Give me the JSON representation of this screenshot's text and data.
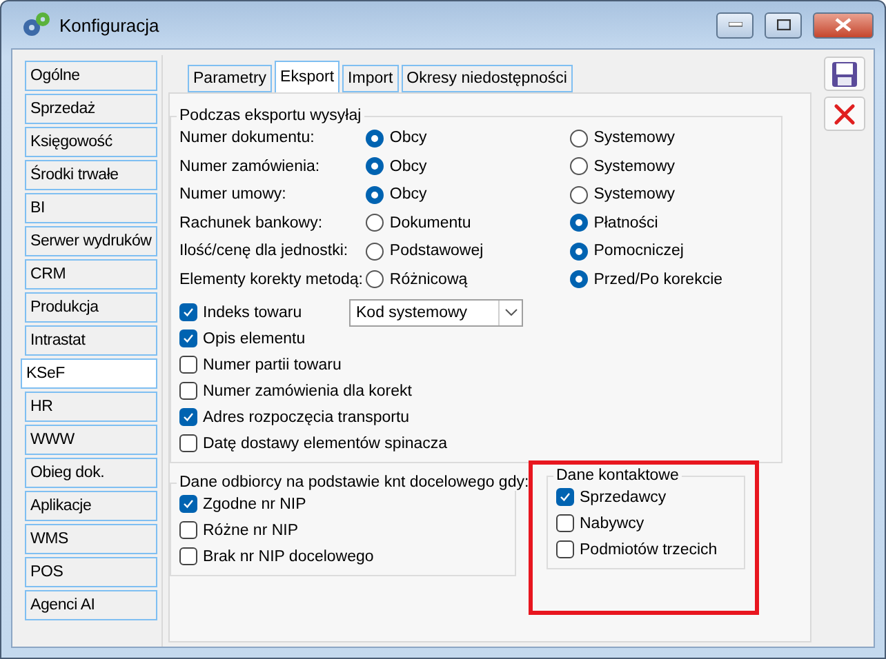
{
  "window": {
    "title": "Konfiguracja"
  },
  "sidebar": {
    "items": [
      {
        "label": "Ogólne",
        "selected": false
      },
      {
        "label": "Sprzedaż",
        "selected": false
      },
      {
        "label": "Księgowość",
        "selected": false
      },
      {
        "label": "Środki trwałe",
        "selected": false
      },
      {
        "label": "BI",
        "selected": false
      },
      {
        "label": "Serwer wydruków",
        "selected": false
      },
      {
        "label": "CRM",
        "selected": false
      },
      {
        "label": "Produkcja",
        "selected": false
      },
      {
        "label": "Intrastat",
        "selected": false
      },
      {
        "label": "KSeF",
        "selected": true
      },
      {
        "label": "HR",
        "selected": false
      },
      {
        "label": "WWW",
        "selected": false
      },
      {
        "label": "Obieg dok.",
        "selected": false
      },
      {
        "label": "Aplikacje",
        "selected": false
      },
      {
        "label": "WMS",
        "selected": false
      },
      {
        "label": "POS",
        "selected": false
      },
      {
        "label": "Agenci AI",
        "selected": false
      }
    ]
  },
  "tabs": [
    {
      "label": "Parametry",
      "selected": false
    },
    {
      "label": "Eksport",
      "selected": true
    },
    {
      "label": "Import",
      "selected": false
    },
    {
      "label": "Okresy niedostępności",
      "selected": false
    }
  ],
  "export_group": {
    "title": "Podczas eksportu wysyłaj",
    "options": [
      {
        "label": "Numer dokumentu:",
        "choices": [
          {
            "label": "Obcy",
            "selected": true
          },
          {
            "label": "Systemowy",
            "selected": false
          }
        ]
      },
      {
        "label": "Numer zamówienia:",
        "choices": [
          {
            "label": "Obcy",
            "selected": true
          },
          {
            "label": "Systemowy",
            "selected": false
          }
        ]
      },
      {
        "label": "Numer umowy:",
        "choices": [
          {
            "label": "Obcy",
            "selected": true
          },
          {
            "label": "Systemowy",
            "selected": false
          }
        ]
      },
      {
        "label": "Rachunek bankowy:",
        "choices": [
          {
            "label": "Dokumentu",
            "selected": false
          },
          {
            "label": "Płatności",
            "selected": true
          }
        ]
      },
      {
        "label": "Ilość/cenę dla jednostki:",
        "choices": [
          {
            "label": "Podstawowej",
            "selected": false
          },
          {
            "label": "Pomocniczej",
            "selected": true
          }
        ]
      },
      {
        "label": "Elementy korekty metodą:",
        "choices": [
          {
            "label": "Różnicową",
            "selected": false
          },
          {
            "label": "Przed/Po korekcie",
            "selected": true
          }
        ]
      }
    ],
    "checks": [
      {
        "label": "Indeks towaru",
        "checked": true,
        "dropdown": "Kod systemowy"
      },
      {
        "label": "Opis elementu",
        "checked": true
      },
      {
        "label": "Numer partii towaru",
        "checked": false
      },
      {
        "label": "Numer zamówienia dla korekt",
        "checked": false
      },
      {
        "label": "Adres rozpoczęcia transportu",
        "checked": true
      },
      {
        "label": "Datę dostawy elementów spinacza",
        "checked": false
      }
    ]
  },
  "recipient_group": {
    "title": "Dane odbiorcy na podstawie knt docelowego gdy:",
    "checks": [
      {
        "label": "Zgodne nr NIP",
        "checked": true
      },
      {
        "label": "Różne nr NIP",
        "checked": false
      },
      {
        "label": "Brak nr NIP docelowego",
        "checked": false
      }
    ]
  },
  "contact_group": {
    "title": "Dane kontaktowe",
    "highlighted": true,
    "checks": [
      {
        "label": "Sprzedawcy",
        "checked": true
      },
      {
        "label": "Nabywcy",
        "checked": false
      },
      {
        "label": "Podmiotów trzecich",
        "checked": false
      }
    ]
  },
  "toolbar": [
    {
      "kind": "save"
    },
    {
      "kind": "cancel"
    }
  ]
}
